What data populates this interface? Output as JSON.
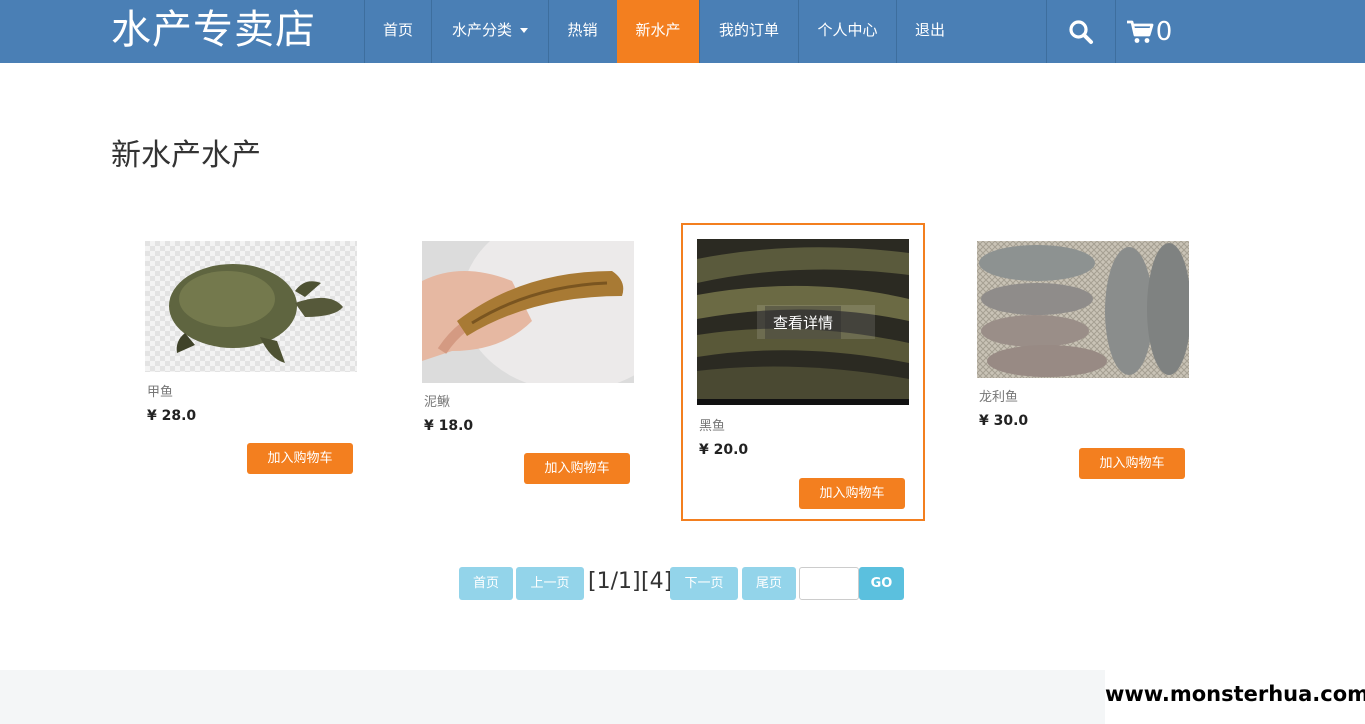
{
  "brand": "水产专卖店",
  "nav": {
    "home": "首页",
    "categories": "水产分类",
    "hot": "热销",
    "new": "新水产",
    "orders": "我的订单",
    "profile": "个人中心",
    "logout": "退出",
    "cart_count": "0",
    "search_icon": "search-icon",
    "cart_icon": "shopping-cart-icon"
  },
  "page_title": "新水产水产",
  "products": [
    {
      "name": "甲鱼",
      "price": "¥ 28.0",
      "button": "加入购物车"
    },
    {
      "name": "泥鳅",
      "price": "¥ 18.0",
      "button": "加入购物车"
    },
    {
      "name": "黑鱼",
      "price": "¥ 20.0",
      "button": "加入购物车",
      "overlay": "查看详情"
    },
    {
      "name": "龙利鱼",
      "price": "¥ 30.0",
      "button": "加入购物车"
    }
  ],
  "pagination": {
    "first": "首页",
    "prev": "上一页",
    "page_info": "[1/1]",
    "total": "[4]",
    "next": "下一页",
    "last": "尾页",
    "go": "GO",
    "input_value": ""
  },
  "watermark": "www.monsterhua.com",
  "colors": {
    "navbar": "#4a7fb5",
    "accent": "#f37f1f",
    "pager": "#93d4ea",
    "go": "#5bc0de"
  }
}
